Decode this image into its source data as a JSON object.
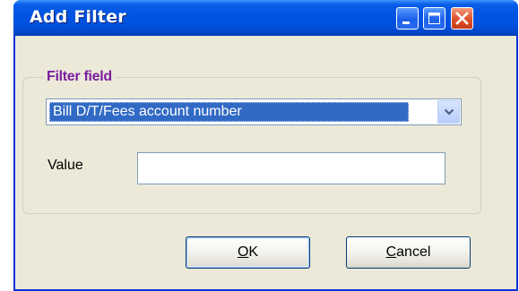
{
  "window": {
    "title": "Add Filter"
  },
  "titlebar_buttons": [
    {
      "name": "minimize",
      "icon": "minimize-icon"
    },
    {
      "name": "maximize",
      "icon": "maximize-icon"
    },
    {
      "name": "close",
      "icon": "close-icon"
    }
  ],
  "filter_group": {
    "legend": "Filter field",
    "field_select": {
      "selected": "Bill D/T/Fees account number",
      "icon": "chevron-down-icon"
    }
  },
  "value_field": {
    "label": "Value",
    "value": ""
  },
  "buttons": {
    "ok": {
      "mnemonic": "O",
      "rest": "K"
    },
    "cancel": {
      "mnemonic": "C",
      "rest": "ancel"
    }
  },
  "colors": {
    "titlebar": "#0054e3",
    "dialog_bg": "#ece9d8",
    "legend": "#7a1ea1",
    "selection": "#316ac5",
    "close_button": "#e0512b"
  }
}
